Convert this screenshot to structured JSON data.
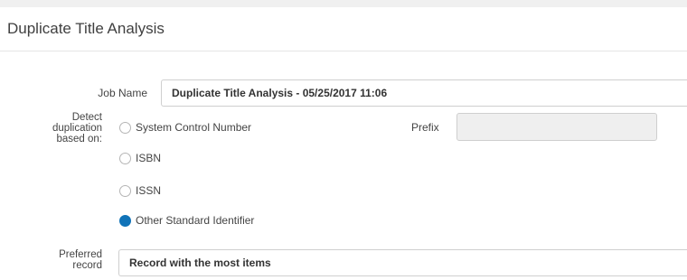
{
  "header": {
    "title": "Duplicate Title Analysis"
  },
  "form": {
    "job_name": {
      "label": "Job Name",
      "value": "Duplicate Title Analysis - 05/25/2017 11:06"
    },
    "detect": {
      "label_lines": [
        "Detect",
        "duplication",
        "based on:"
      ],
      "options": [
        {
          "label": "System Control Number",
          "checked": false
        },
        {
          "label": "ISBN",
          "checked": false
        },
        {
          "label": "ISSN",
          "checked": false
        },
        {
          "label": "Other Standard Identifier",
          "checked": true
        }
      ],
      "selected_color": "#1073b8"
    },
    "prefix": {
      "label": "Prefix",
      "value": "",
      "disabled": true
    },
    "preferred_record": {
      "label_lines": [
        "Preferred",
        "record"
      ],
      "value": "Record with the most items"
    }
  }
}
